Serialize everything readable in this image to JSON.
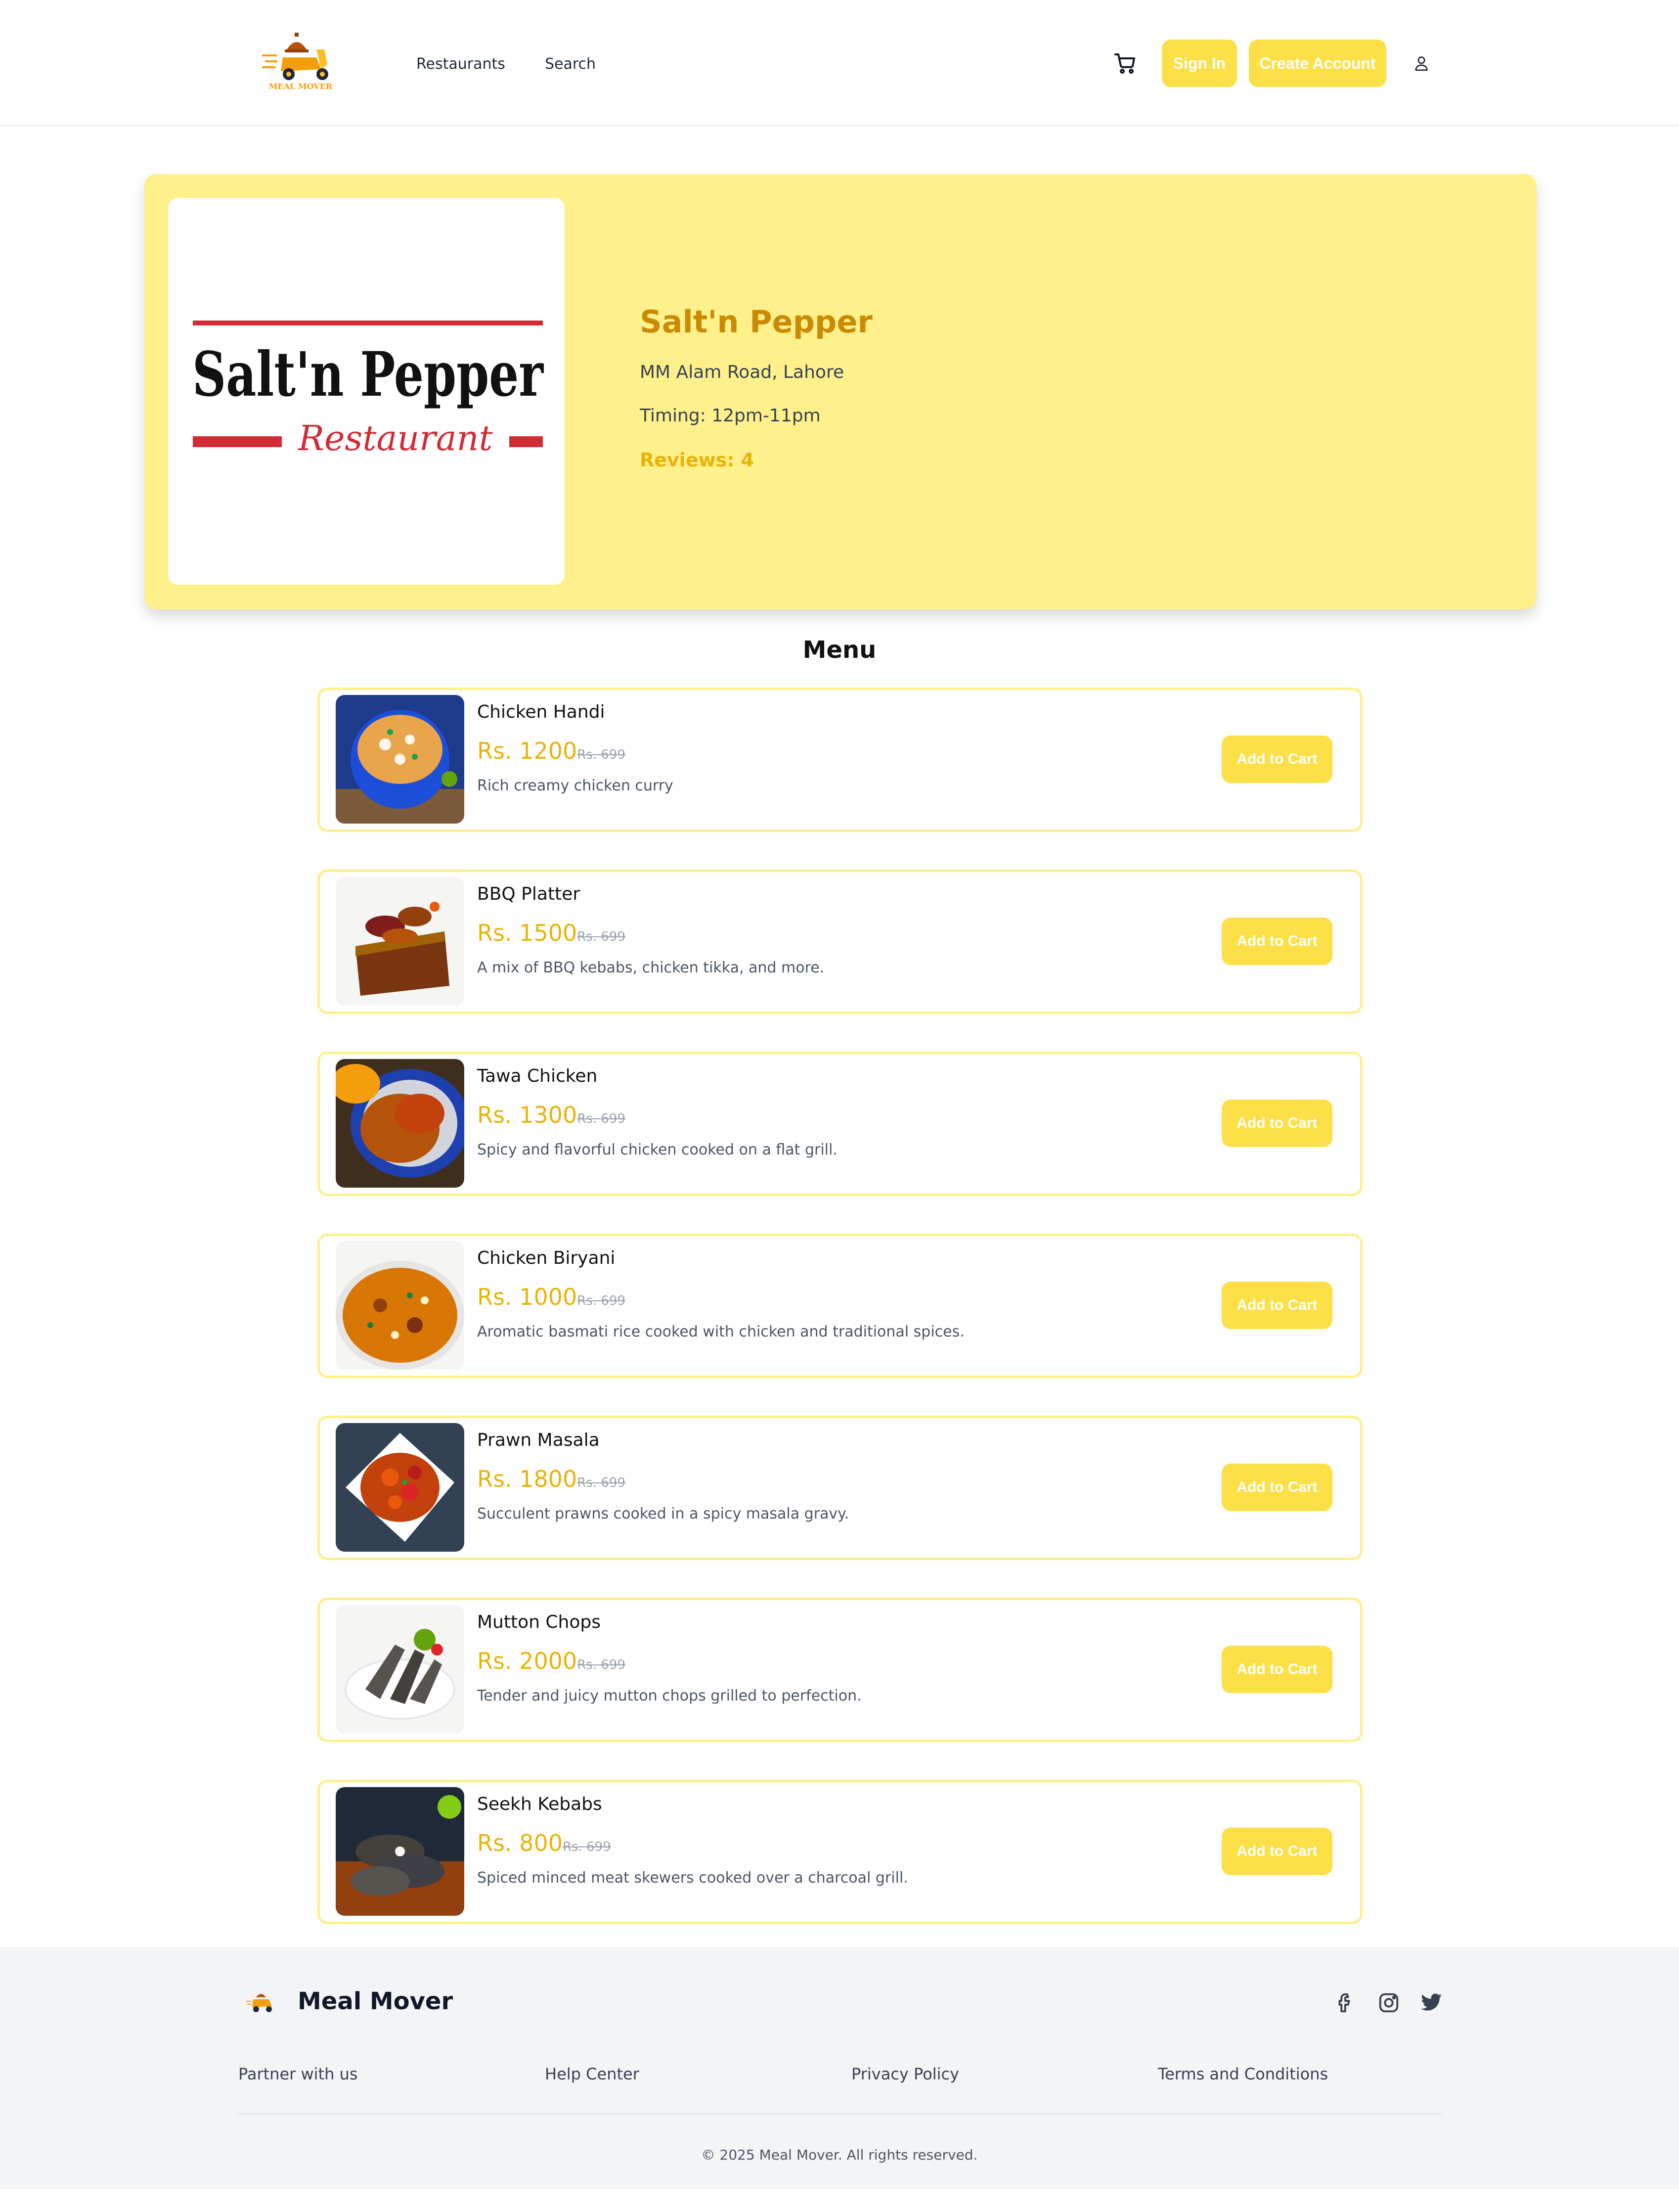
{
  "header": {
    "logo_text": "MEAL MOVER",
    "nav": [
      {
        "label": "Restaurants"
      },
      {
        "label": "Search"
      }
    ],
    "sign_in_label": "Sign In",
    "create_account_label": "Create Account"
  },
  "restaurant": {
    "logo_title": "Salt'n Pepper",
    "logo_subtitle": "Restaurant",
    "name": "Salt'n Pepper",
    "address": "MM Alam Road, Lahore",
    "timing": "Timing: 12pm-11pm",
    "reviews": "Reviews: 4"
  },
  "menu": {
    "title": "Menu",
    "items": [
      {
        "name": "Chicken Handi",
        "price": "Rs. 1200",
        "old_price": "Rs. 699",
        "description": "Rich creamy chicken curry",
        "button": "Add to Cart"
      },
      {
        "name": "BBQ Platter",
        "price": "Rs. 1500",
        "old_price": "Rs. 699",
        "description": "A mix of BBQ kebabs, chicken tikka, and more.",
        "button": "Add to Cart"
      },
      {
        "name": "Tawa Chicken",
        "price": "Rs. 1300",
        "old_price": "Rs. 699",
        "description": "Spicy and flavorful chicken cooked on a flat grill.",
        "button": "Add to Cart"
      },
      {
        "name": "Chicken Biryani",
        "price": "Rs. 1000",
        "old_price": "Rs. 699",
        "description": "Aromatic basmati rice cooked with chicken and traditional spices.",
        "button": "Add to Cart"
      },
      {
        "name": "Prawn Masala",
        "price": "Rs. 1800",
        "old_price": "Rs. 699",
        "description": "Succulent prawns cooked in a spicy masala gravy.",
        "button": "Add to Cart"
      },
      {
        "name": "Mutton Chops",
        "price": "Rs. 2000",
        "old_price": "Rs. 699",
        "description": "Tender and juicy mutton chops grilled to perfection.",
        "button": "Add to Cart"
      },
      {
        "name": "Seekh Kebabs",
        "price": "Rs. 800",
        "old_price": "Rs. 699",
        "description": "Spiced minced meat skewers cooked over a charcoal grill.",
        "button": "Add to Cart"
      }
    ]
  },
  "footer": {
    "brand": "Meal Mover",
    "links": [
      {
        "label": "Partner with us"
      },
      {
        "label": "Help Center"
      },
      {
        "label": "Privacy Policy"
      },
      {
        "label": "Terms and Conditions"
      }
    ],
    "copyright": "© 2025 Meal Mover. All rights reserved."
  },
  "colors": {
    "accent": "#fde047",
    "hero_bg": "#fef08a",
    "brand_dark": "#ca8a04",
    "price": "#eab308"
  }
}
